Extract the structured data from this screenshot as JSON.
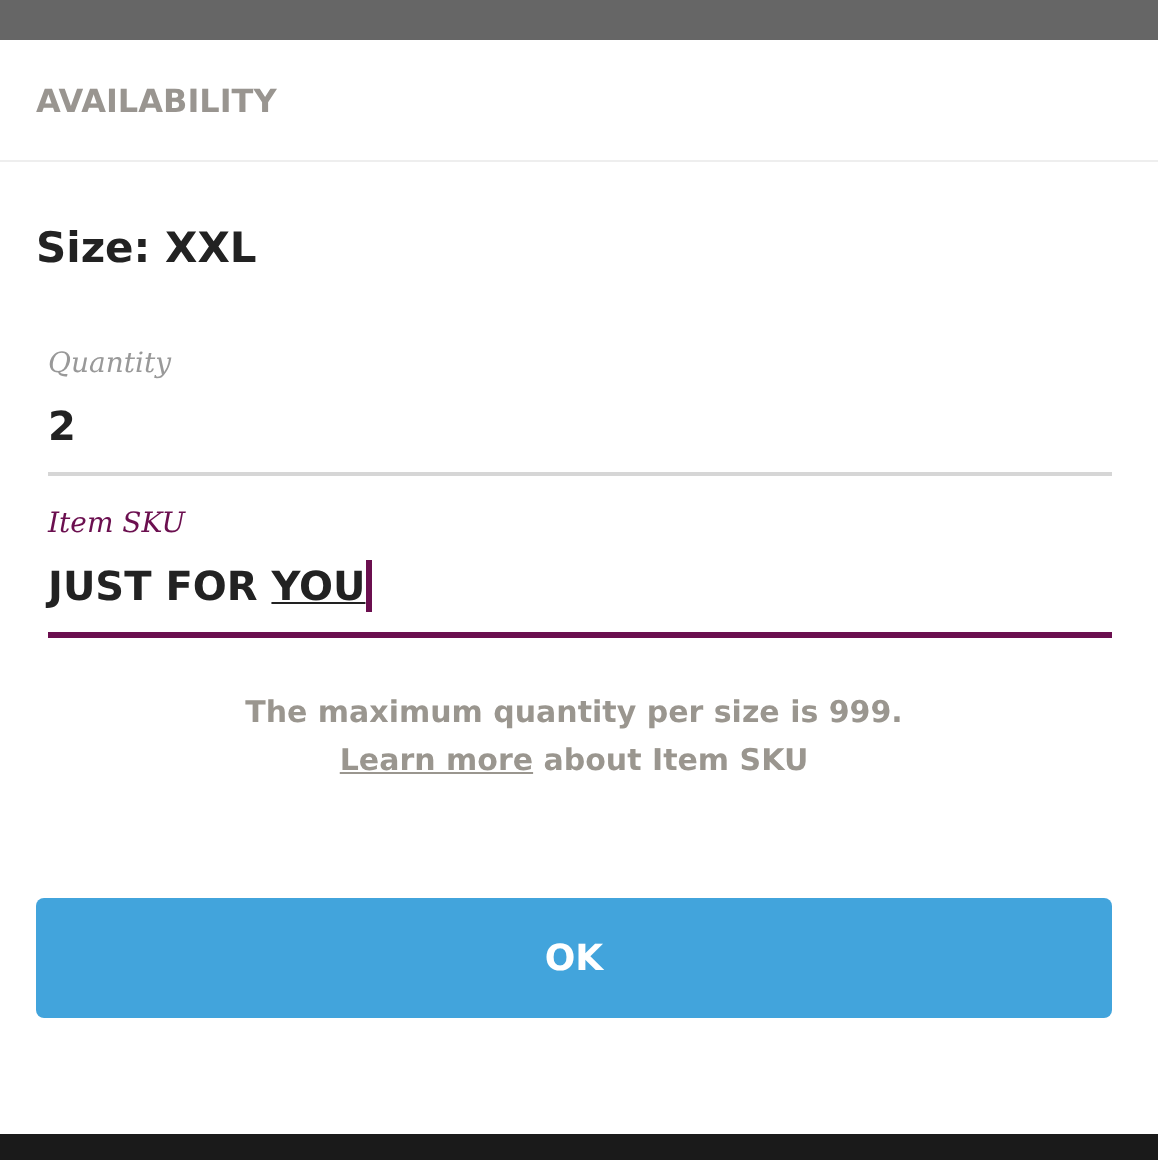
{
  "dialog": {
    "title": "AVAILABILITY",
    "size_label": "Size: XXL",
    "fields": [
      {
        "label": "Quantity",
        "value": "2",
        "focused": false
      },
      {
        "label": "Item SKU",
        "value": "JUST FOR ",
        "composing": "YOU",
        "focused": true
      }
    ],
    "help": {
      "line": "The maximum quantity per size is 999.",
      "link": "Learn more",
      "after_link": " about Item SKU"
    },
    "button": "OK"
  }
}
